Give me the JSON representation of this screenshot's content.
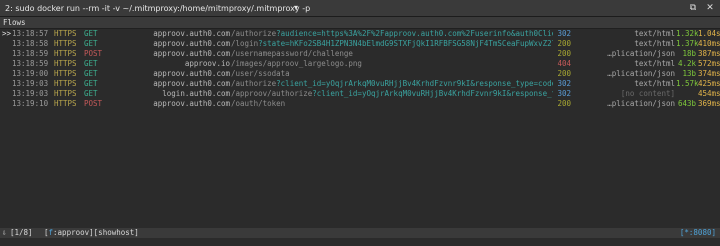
{
  "window": {
    "title": "2: sudo docker run --rm -it -v ~/.mitmproxy:/home/mitmproxy/.mitmproxy -p",
    "dropdown_glyph": "▾",
    "controls": {
      "restore": "⧉",
      "close": "✕"
    }
  },
  "flows_header": "Flows",
  "flows": [
    {
      "mark": ">>",
      "time": "13:18:57",
      "scheme": "HTTPS",
      "method": "GET",
      "host": "approov.auth0.com",
      "path_main": "/authorize",
      "path_query": "?audience=https%3A%2F%2Fapproov.auth0.com%2Fuserinfo&auth0Client",
      "status": "302",
      "content_type": "text/html",
      "size": "1.32k",
      "duration": "1.04s"
    },
    {
      "mark": "",
      "time": "13:18:58",
      "scheme": "HTTPS",
      "method": "GET",
      "host": "approov.auth0.com",
      "path_main": "/login",
      "path_query": "?state=hKFo2SB4H1ZPN3N4bElmdG9STXFjQkI1RFBFSG58NjF4TmSCeaFupWxvZ2lu",
      "status": "200",
      "content_type": "text/html",
      "size": "1.37k",
      "duration": "410ms"
    },
    {
      "mark": "",
      "time": "13:18:59",
      "scheme": "HTTPS",
      "method": "POST",
      "host": "approov.auth0.com",
      "path_main": "/usernamepassword/challenge",
      "path_query": "",
      "status": "200",
      "content_type": "…plication/json",
      "size": "18b",
      "duration": "387ms"
    },
    {
      "mark": "",
      "time": "13:18:59",
      "scheme": "HTTPS",
      "method": "GET",
      "host": "approov.io",
      "path_main": "/images/approov_largelogo.png",
      "path_query": "",
      "status": "404",
      "content_type": "text/html",
      "size": "4.2k",
      "duration": "572ms"
    },
    {
      "mark": "",
      "time": "13:19:00",
      "scheme": "HTTPS",
      "method": "GET",
      "host": "approov.auth0.com",
      "path_main": "/user/ssodata",
      "path_query": "",
      "status": "200",
      "content_type": "…plication/json",
      "size": "13b",
      "duration": "374ms"
    },
    {
      "mark": "",
      "time": "13:19:03",
      "scheme": "HTTPS",
      "method": "GET",
      "host": "approov.auth0.com",
      "path_main": "/authorize",
      "path_query": "?client_id=yOqjrArkqM0vuRHjjBv4KrhdFzvnr9kI&response_type=code&",
      "status": "302",
      "content_type": "text/html",
      "size": "1.57k",
      "duration": "425ms"
    },
    {
      "mark": "",
      "time": "13:19:03",
      "scheme": "HTTPS",
      "method": "GET",
      "host": "login.auth0.com",
      "path_main": "/approov/authorize",
      "path_query": "?client_id=yOqjrArkqM0vuRHjjBv4KrhdFzvnr9kI&response_ty…",
      "status": "302",
      "content_type": "[no content]",
      "size": "",
      "duration": "454ms"
    },
    {
      "mark": "",
      "time": "13:19:10",
      "scheme": "HTTPS",
      "method": "POST",
      "host": "approov.auth0.com",
      "path_main": "/oauth/token",
      "path_query": "",
      "status": "200",
      "content_type": "…plication/json",
      "size": "643b",
      "duration": "369ms"
    }
  ],
  "statusbar": {
    "arrow": "⇩",
    "count": "[1/8]",
    "filter_open": "[",
    "filter_key": "f",
    "filter_value": ":approov]",
    "showhost": "[showhost]",
    "listen": "[*:8080]"
  },
  "colors": {
    "background": "#2b2b2b",
    "get": "#3cae8e",
    "post": "#c55959",
    "status_200": "#a8a832",
    "status_302": "#5a9bd5",
    "status_404": "#c65a5a",
    "size": "#7fc93b",
    "duration": "#e3b54a"
  }
}
